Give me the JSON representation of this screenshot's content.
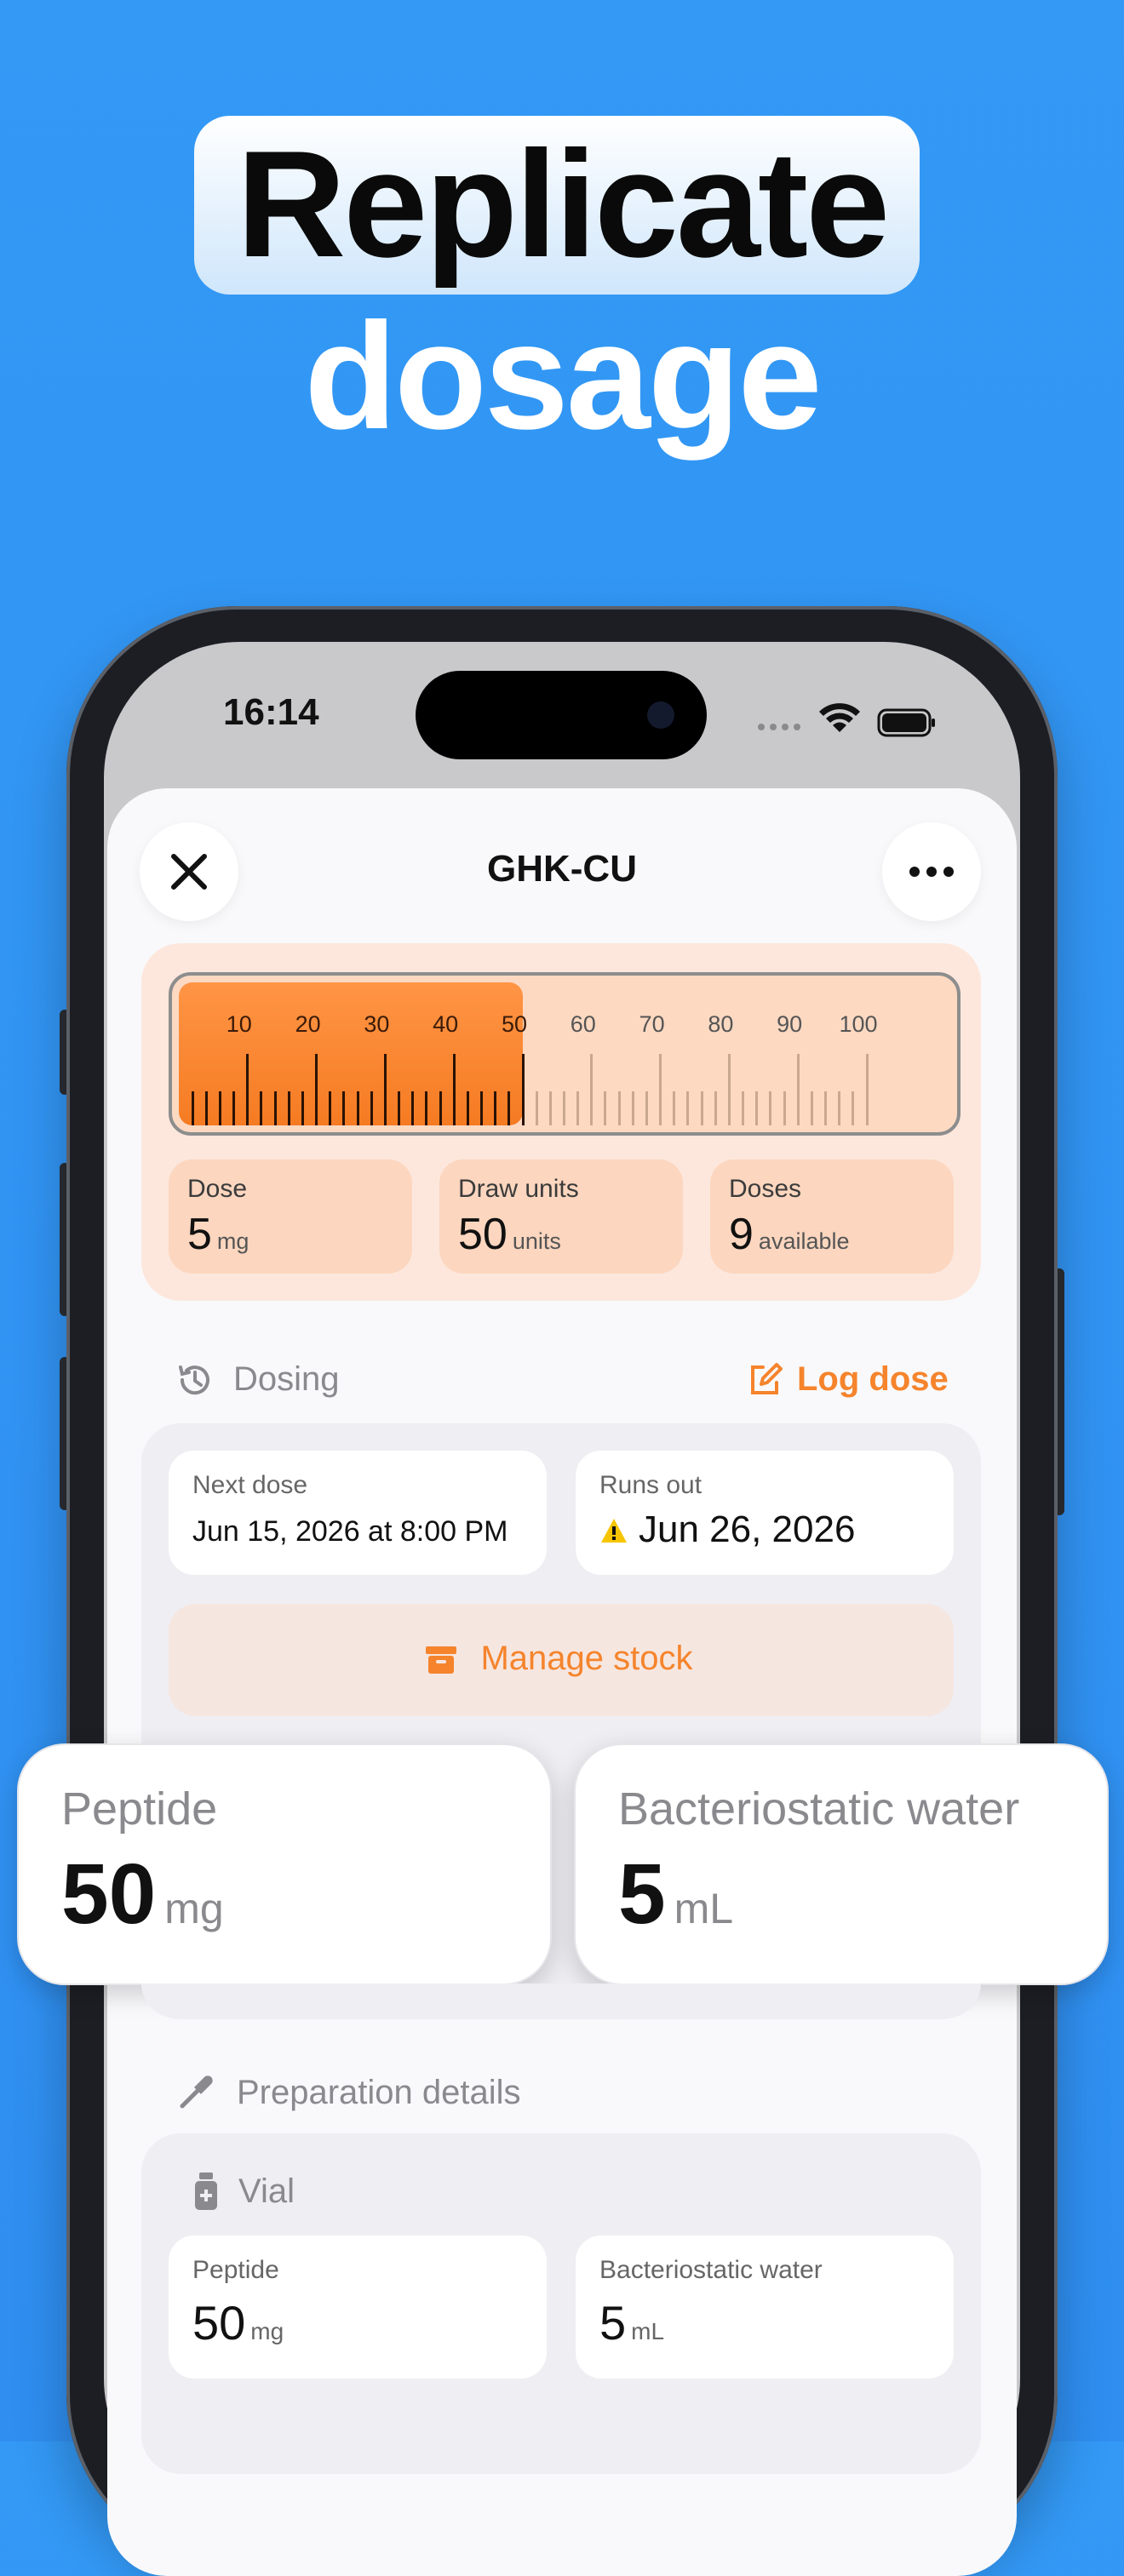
{
  "headline": {
    "line1": "Replicate",
    "line2": "dosage"
  },
  "status_bar": {
    "time": "16:14",
    "icons": [
      "signal-dots-icon",
      "wifi-icon",
      "battery-icon"
    ]
  },
  "sheet": {
    "title": "GHK-CU",
    "close_icon": "close-icon",
    "more_icon": "more-icon"
  },
  "syringe": {
    "fill_units": 50,
    "max_units": 100,
    "ticks": [
      "10",
      "20",
      "30",
      "40",
      "50",
      "60",
      "70",
      "80",
      "90",
      "100"
    ]
  },
  "stats": [
    {
      "label": "Dose",
      "value": "5",
      "unit": "mg"
    },
    {
      "label": "Draw units",
      "value": "50",
      "unit": "units"
    },
    {
      "label": "Doses",
      "value": "9",
      "unit": "available"
    }
  ],
  "dosing": {
    "title": "Dosing",
    "log_dose": "Log dose",
    "next_dose_label": "Next dose",
    "next_dose_value": "Jun 15, 2026 at 8:00 PM",
    "runs_out_label": "Runs out",
    "runs_out_value": "Jun 26, 2026",
    "manage_stock": "Manage stock"
  },
  "float_cards": [
    {
      "label": "Peptide",
      "value": "50",
      "unit": "mg"
    },
    {
      "label": "Bacteriostatic water",
      "value": "5",
      "unit": "mL"
    }
  ],
  "preparation": {
    "title": "Preparation details",
    "vial_title": "Vial",
    "items": [
      {
        "label": "Peptide",
        "value": "50",
        "unit": "mg"
      },
      {
        "label": "Bacteriostatic water",
        "value": "5",
        "unit": "mL"
      }
    ]
  },
  "colors": {
    "accent": "#f5842c",
    "background": "#3399f5"
  }
}
